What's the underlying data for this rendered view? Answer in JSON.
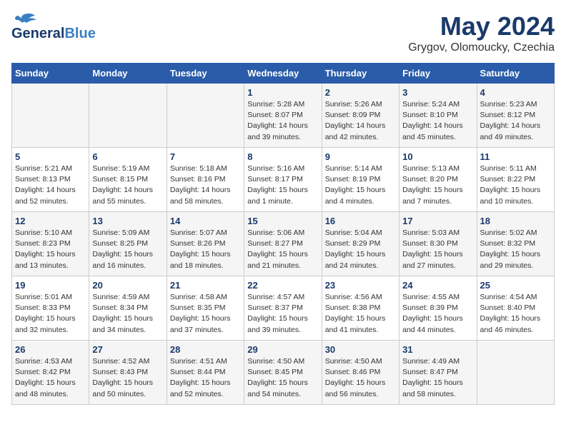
{
  "header": {
    "logo_line1": "General",
    "logo_line2": "Blue",
    "month": "May 2024",
    "location": "Grygov, Olomoucky, Czechia"
  },
  "days_of_week": [
    "Sunday",
    "Monday",
    "Tuesday",
    "Wednesday",
    "Thursday",
    "Friday",
    "Saturday"
  ],
  "weeks": [
    [
      {
        "day": "",
        "info": ""
      },
      {
        "day": "",
        "info": ""
      },
      {
        "day": "",
        "info": ""
      },
      {
        "day": "1",
        "info": "Sunrise: 5:28 AM\nSunset: 8:07 PM\nDaylight: 14 hours\nand 39 minutes."
      },
      {
        "day": "2",
        "info": "Sunrise: 5:26 AM\nSunset: 8:09 PM\nDaylight: 14 hours\nand 42 minutes."
      },
      {
        "day": "3",
        "info": "Sunrise: 5:24 AM\nSunset: 8:10 PM\nDaylight: 14 hours\nand 45 minutes."
      },
      {
        "day": "4",
        "info": "Sunrise: 5:23 AM\nSunset: 8:12 PM\nDaylight: 14 hours\nand 49 minutes."
      }
    ],
    [
      {
        "day": "5",
        "info": "Sunrise: 5:21 AM\nSunset: 8:13 PM\nDaylight: 14 hours\nand 52 minutes."
      },
      {
        "day": "6",
        "info": "Sunrise: 5:19 AM\nSunset: 8:15 PM\nDaylight: 14 hours\nand 55 minutes."
      },
      {
        "day": "7",
        "info": "Sunrise: 5:18 AM\nSunset: 8:16 PM\nDaylight: 14 hours\nand 58 minutes."
      },
      {
        "day": "8",
        "info": "Sunrise: 5:16 AM\nSunset: 8:17 PM\nDaylight: 15 hours\nand 1 minute."
      },
      {
        "day": "9",
        "info": "Sunrise: 5:14 AM\nSunset: 8:19 PM\nDaylight: 15 hours\nand 4 minutes."
      },
      {
        "day": "10",
        "info": "Sunrise: 5:13 AM\nSunset: 8:20 PM\nDaylight: 15 hours\nand 7 minutes."
      },
      {
        "day": "11",
        "info": "Sunrise: 5:11 AM\nSunset: 8:22 PM\nDaylight: 15 hours\nand 10 minutes."
      }
    ],
    [
      {
        "day": "12",
        "info": "Sunrise: 5:10 AM\nSunset: 8:23 PM\nDaylight: 15 hours\nand 13 minutes."
      },
      {
        "day": "13",
        "info": "Sunrise: 5:09 AM\nSunset: 8:25 PM\nDaylight: 15 hours\nand 16 minutes."
      },
      {
        "day": "14",
        "info": "Sunrise: 5:07 AM\nSunset: 8:26 PM\nDaylight: 15 hours\nand 18 minutes."
      },
      {
        "day": "15",
        "info": "Sunrise: 5:06 AM\nSunset: 8:27 PM\nDaylight: 15 hours\nand 21 minutes."
      },
      {
        "day": "16",
        "info": "Sunrise: 5:04 AM\nSunset: 8:29 PM\nDaylight: 15 hours\nand 24 minutes."
      },
      {
        "day": "17",
        "info": "Sunrise: 5:03 AM\nSunset: 8:30 PM\nDaylight: 15 hours\nand 27 minutes."
      },
      {
        "day": "18",
        "info": "Sunrise: 5:02 AM\nSunset: 8:32 PM\nDaylight: 15 hours\nand 29 minutes."
      }
    ],
    [
      {
        "day": "19",
        "info": "Sunrise: 5:01 AM\nSunset: 8:33 PM\nDaylight: 15 hours\nand 32 minutes."
      },
      {
        "day": "20",
        "info": "Sunrise: 4:59 AM\nSunset: 8:34 PM\nDaylight: 15 hours\nand 34 minutes."
      },
      {
        "day": "21",
        "info": "Sunrise: 4:58 AM\nSunset: 8:35 PM\nDaylight: 15 hours\nand 37 minutes."
      },
      {
        "day": "22",
        "info": "Sunrise: 4:57 AM\nSunset: 8:37 PM\nDaylight: 15 hours\nand 39 minutes."
      },
      {
        "day": "23",
        "info": "Sunrise: 4:56 AM\nSunset: 8:38 PM\nDaylight: 15 hours\nand 41 minutes."
      },
      {
        "day": "24",
        "info": "Sunrise: 4:55 AM\nSunset: 8:39 PM\nDaylight: 15 hours\nand 44 minutes."
      },
      {
        "day": "25",
        "info": "Sunrise: 4:54 AM\nSunset: 8:40 PM\nDaylight: 15 hours\nand 46 minutes."
      }
    ],
    [
      {
        "day": "26",
        "info": "Sunrise: 4:53 AM\nSunset: 8:42 PM\nDaylight: 15 hours\nand 48 minutes."
      },
      {
        "day": "27",
        "info": "Sunrise: 4:52 AM\nSunset: 8:43 PM\nDaylight: 15 hours\nand 50 minutes."
      },
      {
        "day": "28",
        "info": "Sunrise: 4:51 AM\nSunset: 8:44 PM\nDaylight: 15 hours\nand 52 minutes."
      },
      {
        "day": "29",
        "info": "Sunrise: 4:50 AM\nSunset: 8:45 PM\nDaylight: 15 hours\nand 54 minutes."
      },
      {
        "day": "30",
        "info": "Sunrise: 4:50 AM\nSunset: 8:46 PM\nDaylight: 15 hours\nand 56 minutes."
      },
      {
        "day": "31",
        "info": "Sunrise: 4:49 AM\nSunset: 8:47 PM\nDaylight: 15 hours\nand 58 minutes."
      },
      {
        "day": "",
        "info": ""
      }
    ]
  ]
}
